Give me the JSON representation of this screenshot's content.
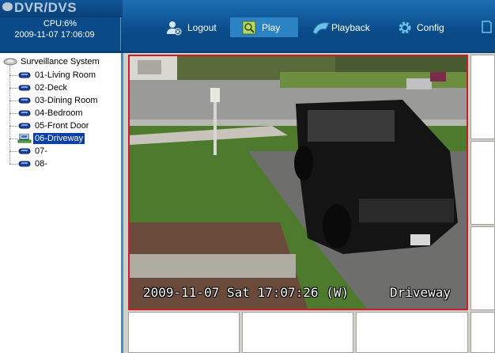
{
  "app": {
    "title": "DVR/DVS"
  },
  "status": {
    "cpu": "CPU:6%",
    "datetime": "2009-11-07 17:06:09"
  },
  "nav": [
    {
      "label": "Logout",
      "icon": "user-logout-icon"
    },
    {
      "label": "Play",
      "icon": "play-icon"
    },
    {
      "label": "Playback",
      "icon": "playback-icon"
    },
    {
      "label": "Config",
      "icon": "gear-icon"
    }
  ],
  "tree": {
    "root": "Surveillance System",
    "channels": [
      {
        "label": "01-Living Room"
      },
      {
        "label": "02-Deck"
      },
      {
        "label": "03-Dining Room"
      },
      {
        "label": "04-Bedroom"
      },
      {
        "label": "05-Front Door"
      },
      {
        "label": "06-Driveway",
        "selected": true
      },
      {
        "label": "07-"
      },
      {
        "label": "08-"
      }
    ]
  },
  "video": {
    "osd_timestamp": "2009-11-07 Sat 17:07:26 (W)",
    "osd_channel": "Driveway"
  },
  "colors": {
    "header": "#0b4d8c",
    "selection": "#0a3fa6",
    "active_frame": "#c8202a"
  }
}
